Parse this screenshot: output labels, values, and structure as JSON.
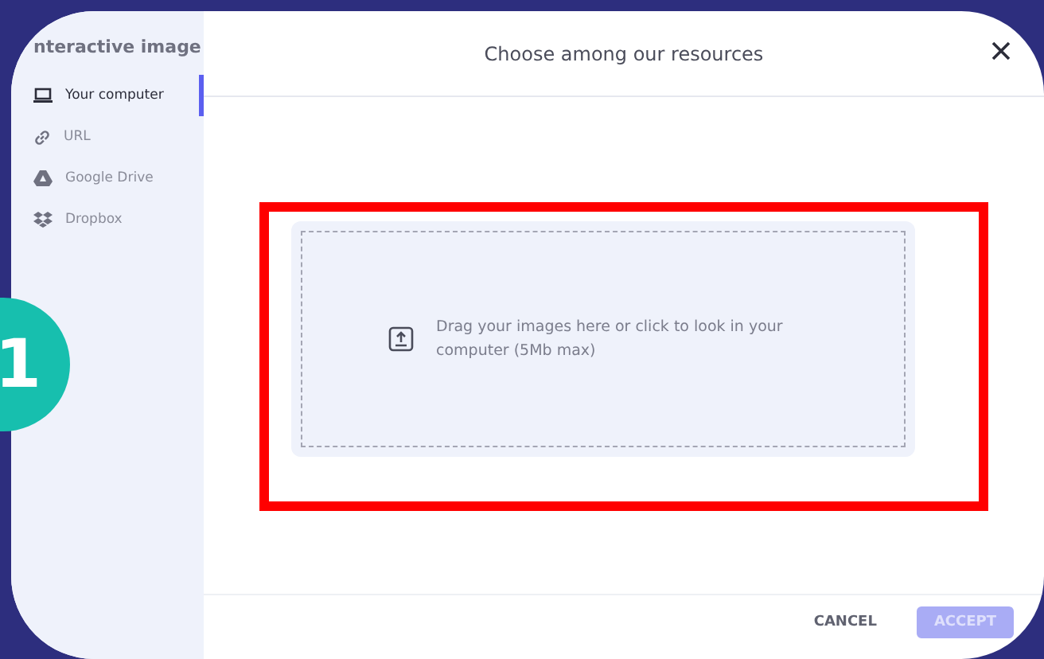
{
  "sidebar": {
    "title": "nteractive image",
    "items": [
      {
        "label": "Your computer",
        "kind": "computer",
        "selected": true
      },
      {
        "label": "URL",
        "kind": "link",
        "selected": false
      },
      {
        "label": "Google Drive",
        "kind": "drive",
        "selected": false
      },
      {
        "label": "Dropbox",
        "kind": "dropbox",
        "selected": false
      }
    ]
  },
  "dialog": {
    "title": "Choose among our resources",
    "drop_zone": {
      "text": "Drag your images here or click to look in your computer (5Mb max)"
    }
  },
  "footer": {
    "buttons": [
      {
        "label": "CANCEL",
        "kind": "text",
        "disabled": false
      },
      {
        "label": "ACCEPT",
        "kind": "primary",
        "disabled": true
      }
    ]
  },
  "step_badge": {
    "label": "1"
  }
}
